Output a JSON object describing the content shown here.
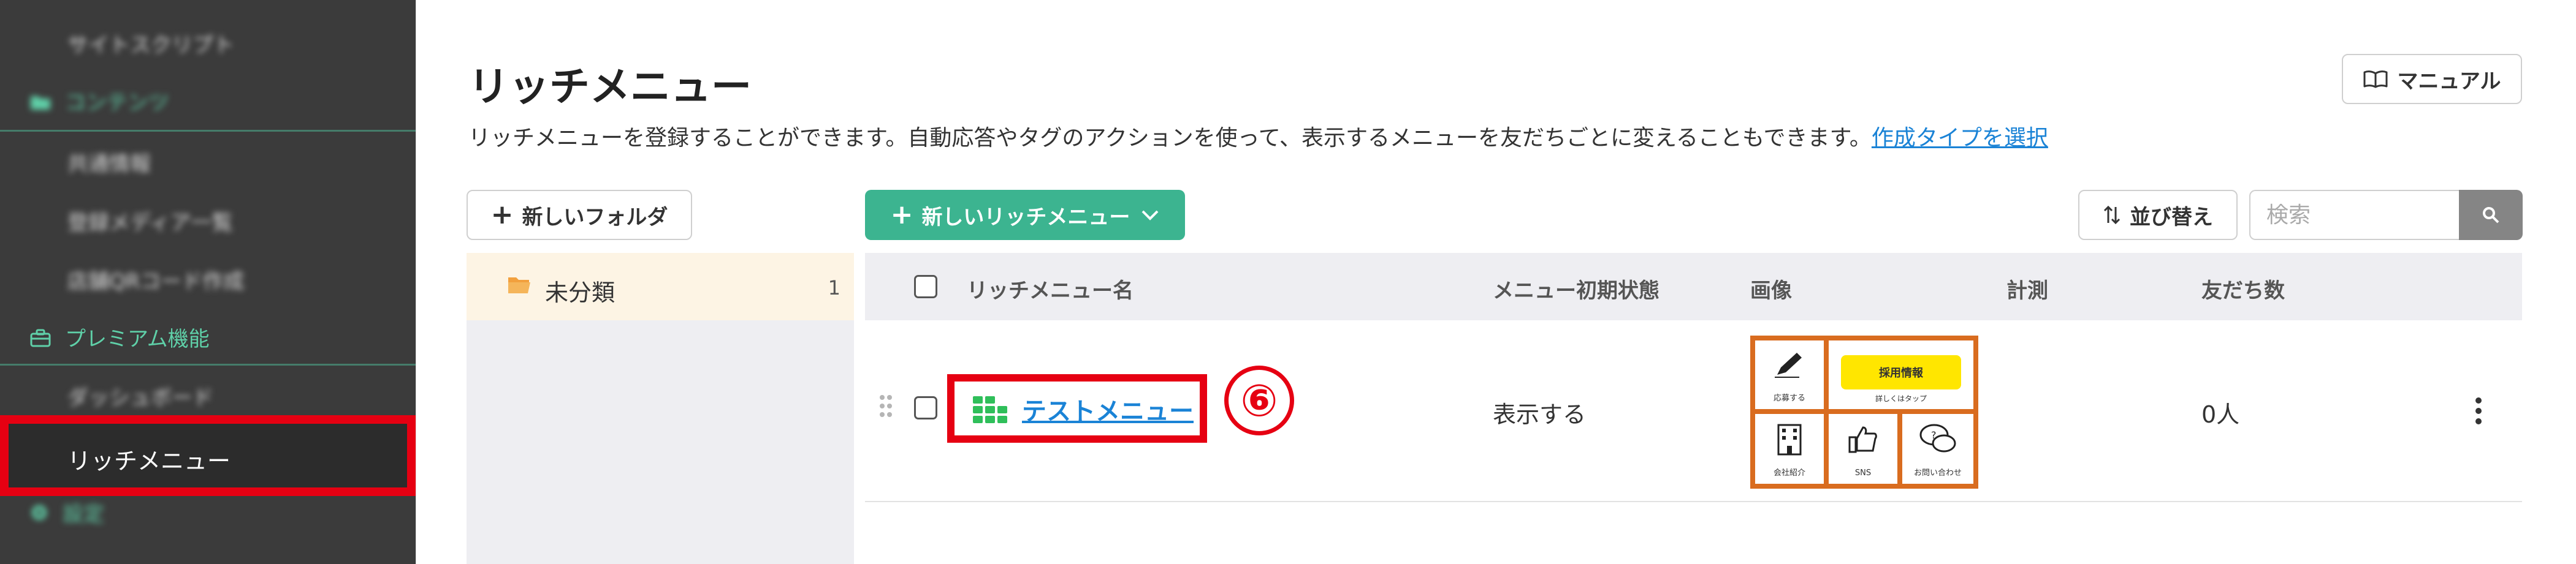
{
  "sidebar": {
    "items": [
      {
        "label": "サイトスクリプト",
        "blurred": true
      },
      {
        "label": "コンテンツ",
        "blurred": true,
        "section": true
      },
      {
        "label": "共通情報",
        "blurred": true
      },
      {
        "label": "登録メディア一覧",
        "blurred": true
      },
      {
        "label": "店舗QRコード作成",
        "blurred": true
      },
      {
        "label": "プレミアム機能",
        "blurred": false,
        "section": true
      },
      {
        "label": "ダッシュボード",
        "blurred": true
      },
      {
        "label": "リッチメニュー",
        "blurred": false,
        "active": true
      },
      {
        "label": "設定",
        "blurred": true,
        "section": true
      }
    ]
  },
  "header": {
    "title": "リッチメニュー",
    "description": "リッチメニューを登録することができます。自動応答やタグのアクションを使って、表示するメニューを友だちごとに変えることもできます。",
    "link_text": "作成タイプを選択",
    "manual_label": "マニュアル"
  },
  "toolbar": {
    "new_folder_label": "新しいフォルダ",
    "new_richmenu_label": "新しいリッチメニュー",
    "sort_label": "並び替え",
    "search_placeholder": "検索"
  },
  "folders": [
    {
      "name": "未分類",
      "count": "1"
    }
  ],
  "table": {
    "columns": [
      "リッチメニュー名",
      "メニュー初期状態",
      "画像",
      "計測",
      "友だち数"
    ],
    "rows": [
      {
        "name": "テストメニュー",
        "initial_state": "表示する",
        "measurement": "",
        "friends": "0人",
        "image_tiles": [
          "応募する",
          "採用情報",
          "詳しくはタップ",
          "会社紹介",
          "SNS",
          "お問い合わせ"
        ]
      }
    ]
  },
  "annotation": {
    "step_marker": "⑥",
    "color": "#e60012"
  },
  "colors": {
    "accent_green": "#3cb490",
    "link_blue": "#1a83d6",
    "sidebar_bg": "#3b3b3b",
    "highlight_red": "#e60012"
  }
}
